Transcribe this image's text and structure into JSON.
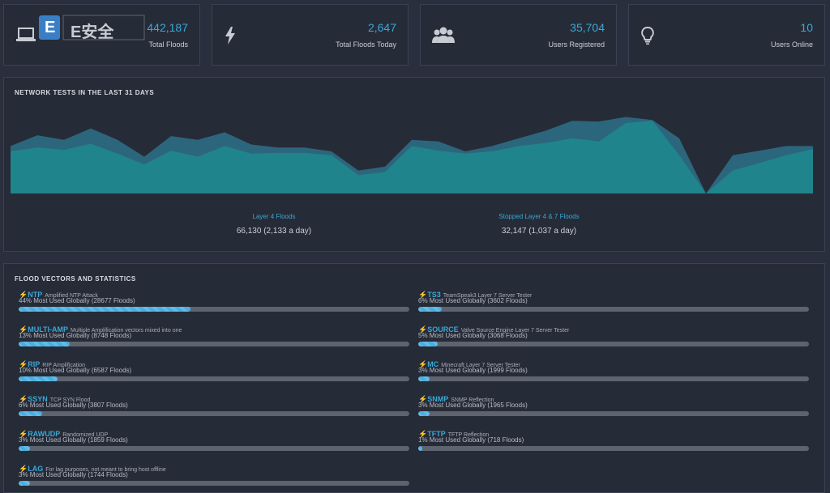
{
  "stats": [
    {
      "icon": "laptop-icon",
      "value": "442,187",
      "label": "Total Floods"
    },
    {
      "icon": "bolt-icon",
      "value": "2,647",
      "label": "Total Floods Today"
    },
    {
      "icon": "users-icon",
      "value": "35,704",
      "label": "Users Registered"
    },
    {
      "icon": "lightbulb-icon",
      "value": "10",
      "label": "Users Online"
    }
  ],
  "logo": {
    "text": "E安全",
    "badge": "E"
  },
  "network": {
    "title": "NETWORK TESTS IN THE LAST 31 DAYS",
    "legend": [
      {
        "label": "Layer 4 Floods",
        "value": "66,130 (2,133 a day)"
      },
      {
        "label": "Stopped Layer 4 & 7 Floods",
        "value": "32,147 (1,037 a day)"
      }
    ]
  },
  "chart_data": {
    "type": "area",
    "title": "NETWORK TESTS IN THE LAST 31 DAYS",
    "xlabel": "",
    "ylabel": "",
    "grid": false,
    "colors": {
      "layer4": "#2d6d84",
      "stopped": "#1e8a8f",
      "overlay": "#1f7a6f"
    },
    "x": [
      1,
      2,
      3,
      4,
      5,
      6,
      7,
      8,
      9,
      10,
      11,
      12,
      13,
      14,
      15,
      16,
      17,
      18,
      19,
      20,
      21,
      22,
      23,
      24,
      25,
      26,
      27,
      28,
      29,
      30,
      31
    ],
    "series": [
      {
        "name": "Layer 4 Floods",
        "values": [
          62,
          76,
          70,
          85,
          70,
          48,
          75,
          70,
          80,
          64,
          60,
          60,
          55,
          30,
          35,
          70,
          68,
          55,
          62,
          72,
          82,
          95,
          94,
          100,
          96,
          72,
          0,
          50,
          56,
          62,
          62
        ]
      },
      {
        "name": "Stopped Layer 4 & 7 Floods",
        "values": [
          55,
          60,
          57,
          65,
          52,
          38,
          56,
          48,
          62,
          52,
          53,
          53,
          50,
          24,
          28,
          62,
          56,
          52,
          55,
          62,
          66,
          72,
          68,
          92,
          95,
          50,
          0,
          30,
          40,
          50,
          58
        ]
      }
    ],
    "ylim": [
      0,
      110
    ]
  },
  "vectors_section": {
    "title": "FLOOD VECTORS AND STATISTICS",
    "left": [
      {
        "name": "NTP",
        "desc": "Amplified NTP Attack",
        "stat": "44% Most Used Globally (28677 Floods)",
        "percent": 44
      },
      {
        "name": "MULTI-AMP",
        "desc": "Multiple Amplification vectors mixed into one",
        "stat": "13% Most Used Globally (8748 Floods)",
        "percent": 13
      },
      {
        "name": "RIP",
        "desc": "RIP Amplification",
        "stat": "10% Most Used Globally (6587 Floods)",
        "percent": 10
      },
      {
        "name": "SSYN",
        "desc": "TCP SYN Flood",
        "stat": "6% Most Used Globally (3807 Floods)",
        "percent": 6
      },
      {
        "name": "RAWUDP",
        "desc": "Randomized UDP",
        "stat": "3% Most Used Globally (1859 Floods)",
        "percent": 3
      },
      {
        "name": "LAG",
        "desc": "For lag purposes, not meant to bring host offline",
        "stat": "3% Most Used Globally (1744 Floods)",
        "percent": 3
      }
    ],
    "right": [
      {
        "name": "TS3",
        "desc": "TeamSpeak3 Layer 7 Server Tester",
        "stat": "6% Most Used Globally (3602 Floods)",
        "percent": 6
      },
      {
        "name": "SOURCE",
        "desc": "Valve Source Engine Layer 7 Server Tester",
        "stat": "5% Most Used Globally (3068 Floods)",
        "percent": 5
      },
      {
        "name": "MC",
        "desc": "Minecraft Layer 7 Server Tester",
        "stat": "3% Most Used Globally (1999 Floods)",
        "percent": 3
      },
      {
        "name": "SNMP",
        "desc": "SNMP Reflection",
        "stat": "3% Most Used Globally (1965 Floods)",
        "percent": 3
      },
      {
        "name": "TFTP",
        "desc": "TFTP Reflection",
        "stat": "1% Most Used Globally (718 Floods)",
        "percent": 1
      }
    ]
  }
}
